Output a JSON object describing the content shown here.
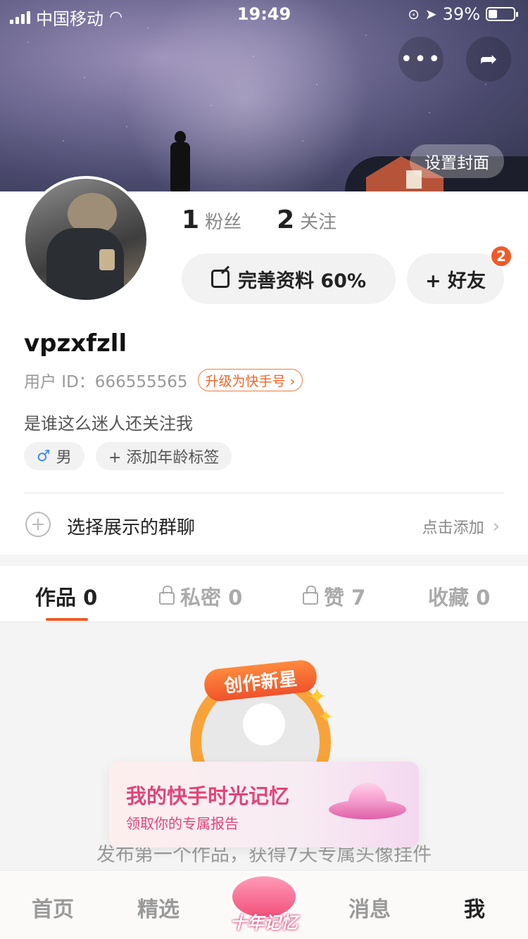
{
  "status_bar": {
    "carrier": "中国移动",
    "time": "19:49",
    "battery": "39%"
  },
  "cover": {
    "set_cover_label": "设置封面"
  },
  "profile": {
    "fans_count": "1",
    "fans_label": "粉丝",
    "following_count": "2",
    "following_label": "关注",
    "edit_profile_label": "完善资料 60%",
    "add_friend_label": "+ 好友",
    "friend_badge": "2",
    "username": "vpzxfzll",
    "user_id": "用户 ID：666555565",
    "upgrade_label": "升级为快手号 ›",
    "bio": "是谁这么迷人还关注我",
    "gender_symbol": "♂",
    "gender_label": "男",
    "age_tag_label": "+ 添加年龄标签",
    "group_label": "选择展示的群聊",
    "group_add_label": "点击添加"
  },
  "tabs": [
    {
      "label": "作品 0"
    },
    {
      "label": "私密 0"
    },
    {
      "label": "赞 7"
    },
    {
      "label": "收藏 0"
    }
  ],
  "content": {
    "frame_badge": "创作新星",
    "publish_hint": "发布第一个作品，获得7天专属头像挂件"
  },
  "memory_card": {
    "title": "我的快手时光记忆",
    "subtitle": "领取你的专属报告"
  },
  "bottom_nav": {
    "home": "首页",
    "featured": "精选",
    "center": "十年记忆",
    "messages": "消息",
    "me": "我"
  }
}
